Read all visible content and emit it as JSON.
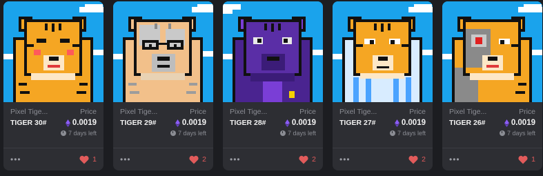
{
  "cards": [
    {
      "collection": "Pixel Tige...",
      "token": "TIGER 30#",
      "price_label": "Price",
      "price": "0.0019",
      "time_left": "7 days left",
      "likes": "1",
      "variant": "blush",
      "colors": {
        "sky": "#1aa3ec",
        "fur": "#f5a623",
        "body": "#f5a623"
      }
    },
    {
      "collection": "Pixel Tige...",
      "token": "TIGER 29#",
      "price_label": "Price",
      "price": "0.0019",
      "time_left": "7 days left",
      "likes": "2",
      "variant": "glasses",
      "colors": {
        "sky": "#1aa3ec",
        "fur": "#f2c08a",
        "body": "#f2c08a"
      }
    },
    {
      "collection": "Pixel Tige...",
      "token": "TIGER 28#",
      "price_label": "Price",
      "price": "0.0019",
      "time_left": "7 days left",
      "likes": "2",
      "variant": "purple",
      "colors": {
        "sky": "#1aa3ec",
        "fur": "#5a2ea6",
        "body": "#4a2490"
      }
    },
    {
      "collection": "Pixel Tige...",
      "token": "TIGER 27#",
      "price_label": "Price",
      "price": "0.0019",
      "time_left": "7 days left",
      "likes": "2",
      "variant": "striped-shirt",
      "colors": {
        "sky": "#1aa3ec",
        "fur": "#f5a623",
        "body": "#d8ecff"
      }
    },
    {
      "collection": "Pixel Tige...",
      "token": "TIGER 26#",
      "price_label": "Price",
      "price": "0.0019",
      "time_left": "7 days left",
      "likes": "1",
      "variant": "cyborg",
      "colors": {
        "sky": "#1aa3ec",
        "fur": "#f5a623",
        "body": "#8a8a8a"
      }
    }
  ],
  "theme": {
    "page_bg": "#1c1d21",
    "card_bg": "#2d2e33",
    "muted": "#8b8d94",
    "heart": "#e25b5b",
    "eth": "#8a5cf6"
  },
  "icons": [
    "eth-icon",
    "clock-icon",
    "more-icon",
    "heart-icon"
  ]
}
